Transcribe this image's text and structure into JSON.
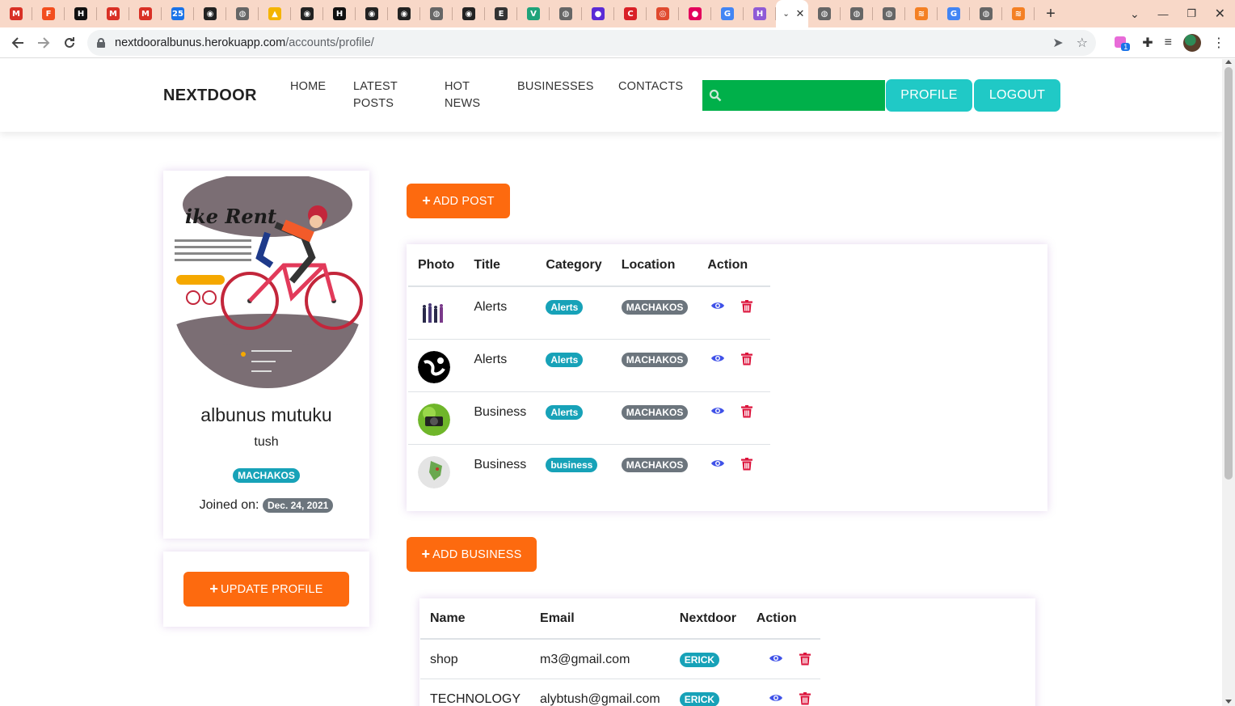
{
  "browser": {
    "url_host": "nextdooralbunus.herokuapp.com",
    "url_path": "/accounts/profile/",
    "tabs": [
      {
        "icon": "gmail-icon",
        "color": "#d93025",
        "glyph": "M"
      },
      {
        "icon": "figma-icon",
        "color": "#f24e1e",
        "glyph": "F"
      },
      {
        "icon": "hn-icon",
        "color": "#111111",
        "glyph": "H"
      },
      {
        "icon": "gmail-icon",
        "color": "#d93025",
        "glyph": "M"
      },
      {
        "icon": "gmail-icon",
        "color": "#d93025",
        "glyph": "M"
      },
      {
        "icon": "calendar-icon",
        "color": "#1a73e8",
        "glyph": "25"
      },
      {
        "icon": "github-icon",
        "color": "#222222",
        "glyph": "◉"
      },
      {
        "icon": "globe-icon",
        "color": "#666666",
        "glyph": "◍"
      },
      {
        "icon": "drive-icon",
        "color": "#f4b400",
        "glyph": "▲"
      },
      {
        "icon": "github-icon",
        "color": "#222222",
        "glyph": "◉"
      },
      {
        "icon": "hn-icon",
        "color": "#111111",
        "glyph": "H"
      },
      {
        "icon": "github-icon",
        "color": "#222222",
        "glyph": "◉"
      },
      {
        "icon": "github-icon",
        "color": "#222222",
        "glyph": "◉"
      },
      {
        "icon": "globe-icon",
        "color": "#666666",
        "glyph": "◍"
      },
      {
        "icon": "github-icon",
        "color": "#222222",
        "glyph": "◉"
      },
      {
        "icon": "audio-icon",
        "color": "#333333",
        "glyph": "E"
      },
      {
        "icon": "vue-icon",
        "color": "#1fa37a",
        "glyph": "V"
      },
      {
        "icon": "globe-icon",
        "color": "#666666",
        "glyph": "◍"
      },
      {
        "icon": "circle-icon",
        "color": "#5b2bd6",
        "glyph": "●"
      },
      {
        "icon": "c-icon",
        "color": "#d92027",
        "glyph": "C"
      },
      {
        "icon": "ring-icon",
        "color": "#e04a2f",
        "glyph": "◎"
      },
      {
        "icon": "dot-icon",
        "color": "#e3005c",
        "glyph": "●"
      },
      {
        "icon": "google-icon",
        "color": "#4285f4",
        "glyph": "G"
      },
      {
        "icon": "h-icon",
        "color": "#8f5bd6",
        "glyph": "H"
      }
    ],
    "tabs_after": [
      {
        "icon": "globe-icon",
        "color": "#666666",
        "glyph": "◍"
      },
      {
        "icon": "globe-icon",
        "color": "#666666",
        "glyph": "◍"
      },
      {
        "icon": "globe-icon",
        "color": "#666666",
        "glyph": "◍"
      },
      {
        "icon": "stack-icon",
        "color": "#f48024",
        "glyph": "≋"
      },
      {
        "icon": "google-icon",
        "color": "#4285f4",
        "glyph": "G"
      },
      {
        "icon": "globe-icon",
        "color": "#666666",
        "glyph": "◍"
      },
      {
        "icon": "stack-icon",
        "color": "#f48024",
        "glyph": "≋"
      }
    ],
    "ext_badge": "1"
  },
  "nav": {
    "brand": "NEXTDOOR",
    "home": "HOME",
    "latest_posts_1": "LATEST",
    "latest_posts_2": "POSTS",
    "hot_news_1": "HOT",
    "hot_news_2": "NEWS",
    "businesses": "BUSINESSES",
    "contacts": "CONTACTS",
    "profile": "PROFILE",
    "logout": "LOGOUT",
    "search_value": ""
  },
  "profile": {
    "name": "albunus mutuku",
    "username": "tush",
    "location": "MACHAKOS",
    "joined_label": "Joined on:",
    "joined_date": "Dec. 24, 2021",
    "avatar_heading": "ike Rent",
    "update_button": "UPDATE PROFILE"
  },
  "posts": {
    "add_button": "ADD POST",
    "headers": {
      "photo": "Photo",
      "title": "Title",
      "category": "Category",
      "location": "Location",
      "action": "Action"
    },
    "rows": [
      {
        "title": "Alerts",
        "category": "Alerts",
        "location": "MACHAKOS",
        "thumb": "people"
      },
      {
        "title": "Alerts",
        "category": "Alerts",
        "location": "MACHAKOS",
        "thumb": "globe"
      },
      {
        "title": "Business",
        "category": "Alerts",
        "location": "MACHAKOS",
        "thumb": "camera"
      },
      {
        "title": "Business",
        "category": "business",
        "location": "MACHAKOS",
        "thumb": "map"
      }
    ]
  },
  "businesses": {
    "add_button": "ADD BUSINESS",
    "headers": {
      "name": "Name",
      "email": "Email",
      "nextdoor": "Nextdoor",
      "action": "Action"
    },
    "rows": [
      {
        "name": "shop",
        "email": "m3@gmail.com",
        "nextdoor": "ERICK"
      },
      {
        "name": "TECHNOLOGY",
        "email": "alybtush@gmail.com",
        "nextdoor": "ERICK"
      }
    ]
  },
  "colors": {
    "accent_teal": "#20c9c6",
    "search_green": "#00b04a",
    "button_orange": "#fd6a0f",
    "badge_info": "#17a2b8",
    "badge_dark": "#6c757d",
    "view_blue": "#3f51e8",
    "delete_red": "#dc143c"
  }
}
